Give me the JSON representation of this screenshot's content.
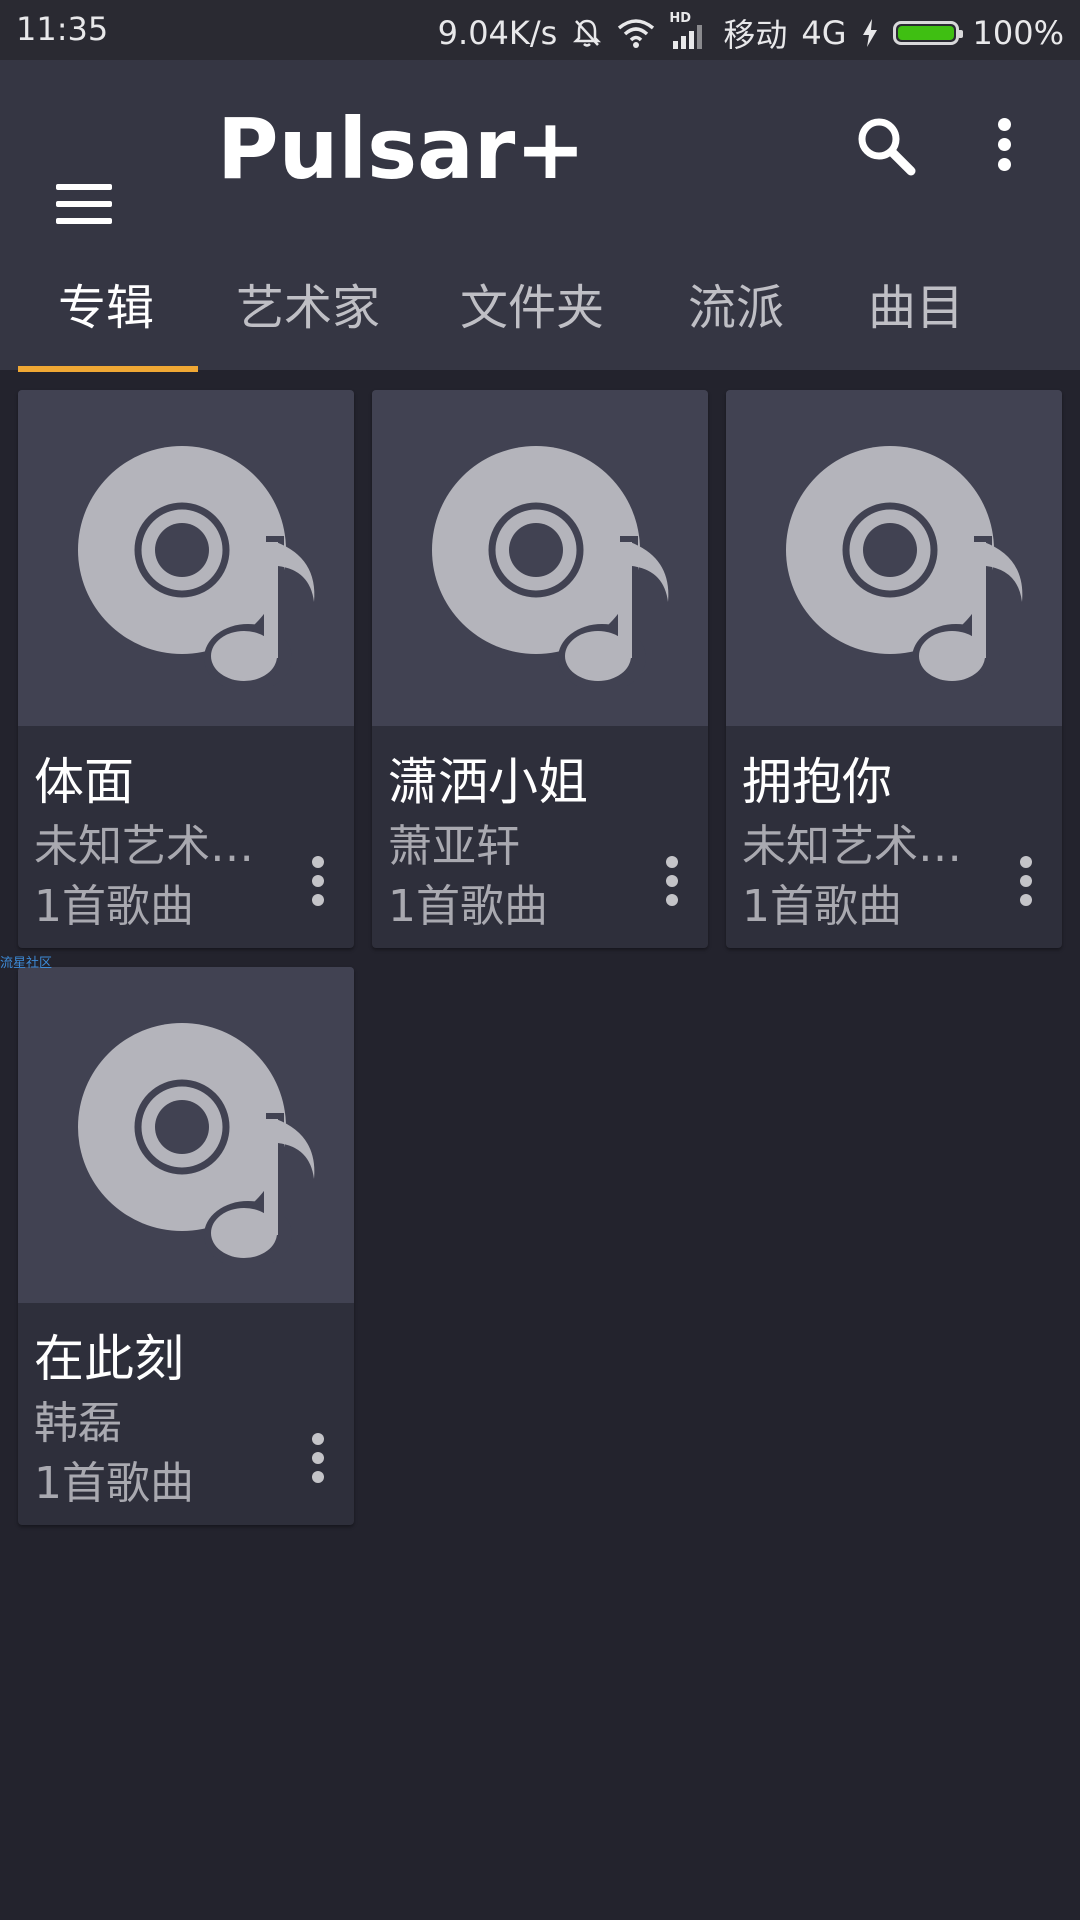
{
  "status_bar": {
    "time": "11:35",
    "speed": "9.04K/s",
    "network_hd": "HD",
    "carrier": "移动",
    "network": "4G",
    "battery": "100%",
    "battery_color": "#3fbf12"
  },
  "app_bar": {
    "title": "Pulsar+",
    "menu_icon": "hamburger-menu-icon",
    "search_icon": "search-icon",
    "more_icon": "more-vert-icon"
  },
  "tabs": [
    {
      "label": "专辑",
      "active": true
    },
    {
      "label": "艺术家",
      "active": false
    },
    {
      "label": "文件夹",
      "active": false
    },
    {
      "label": "流派",
      "active": false
    },
    {
      "label": "曲目",
      "active": false
    }
  ],
  "accent_color": "#f0a834",
  "albums": [
    {
      "name": "体面",
      "artist": "未知艺术…",
      "count": "1首歌曲"
    },
    {
      "name": "潇洒小姐",
      "artist": "萧亚轩",
      "count": "1首歌曲"
    },
    {
      "name": "拥抱你",
      "artist": "未知艺术…",
      "count": "1首歌曲"
    },
    {
      "name": "在此刻",
      "artist": "韩磊",
      "count": "1首歌曲"
    }
  ],
  "watermark": "流星社区"
}
